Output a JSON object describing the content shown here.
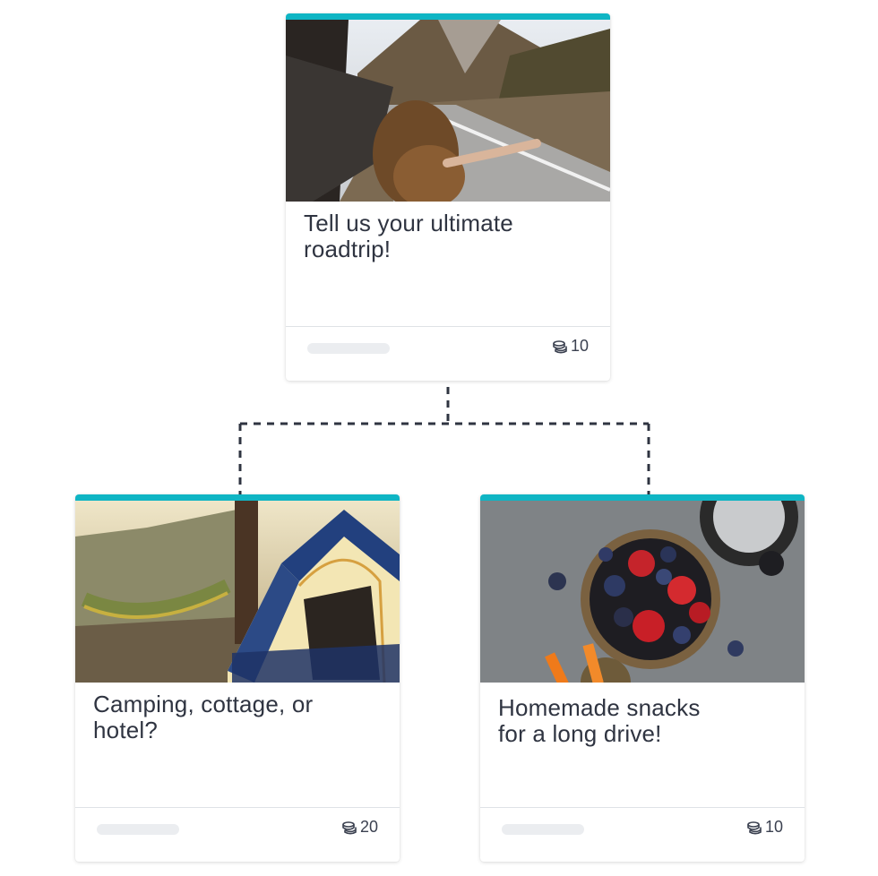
{
  "cards": [
    {
      "title_line1": "Tell us your ultimate",
      "title_line2": "roadtrip!",
      "points": "10",
      "photo": "woman-in-car-roadtrip-photo"
    },
    {
      "title_line1": "Camping, cottage, or",
      "title_line2": "hotel?",
      "points": "20",
      "photo": "camping-tent-hammock-photo"
    },
    {
      "title_line1": "Homemade snacks",
      "title_line2": "for a long drive!",
      "points": "10",
      "photo": "berries-snacks-photo"
    }
  ],
  "colors": {
    "accent": "#0fb5c4",
    "connector": "#2f3441",
    "text": "#2f3441"
  },
  "icons": {
    "points": "coin-stack-icon"
  }
}
